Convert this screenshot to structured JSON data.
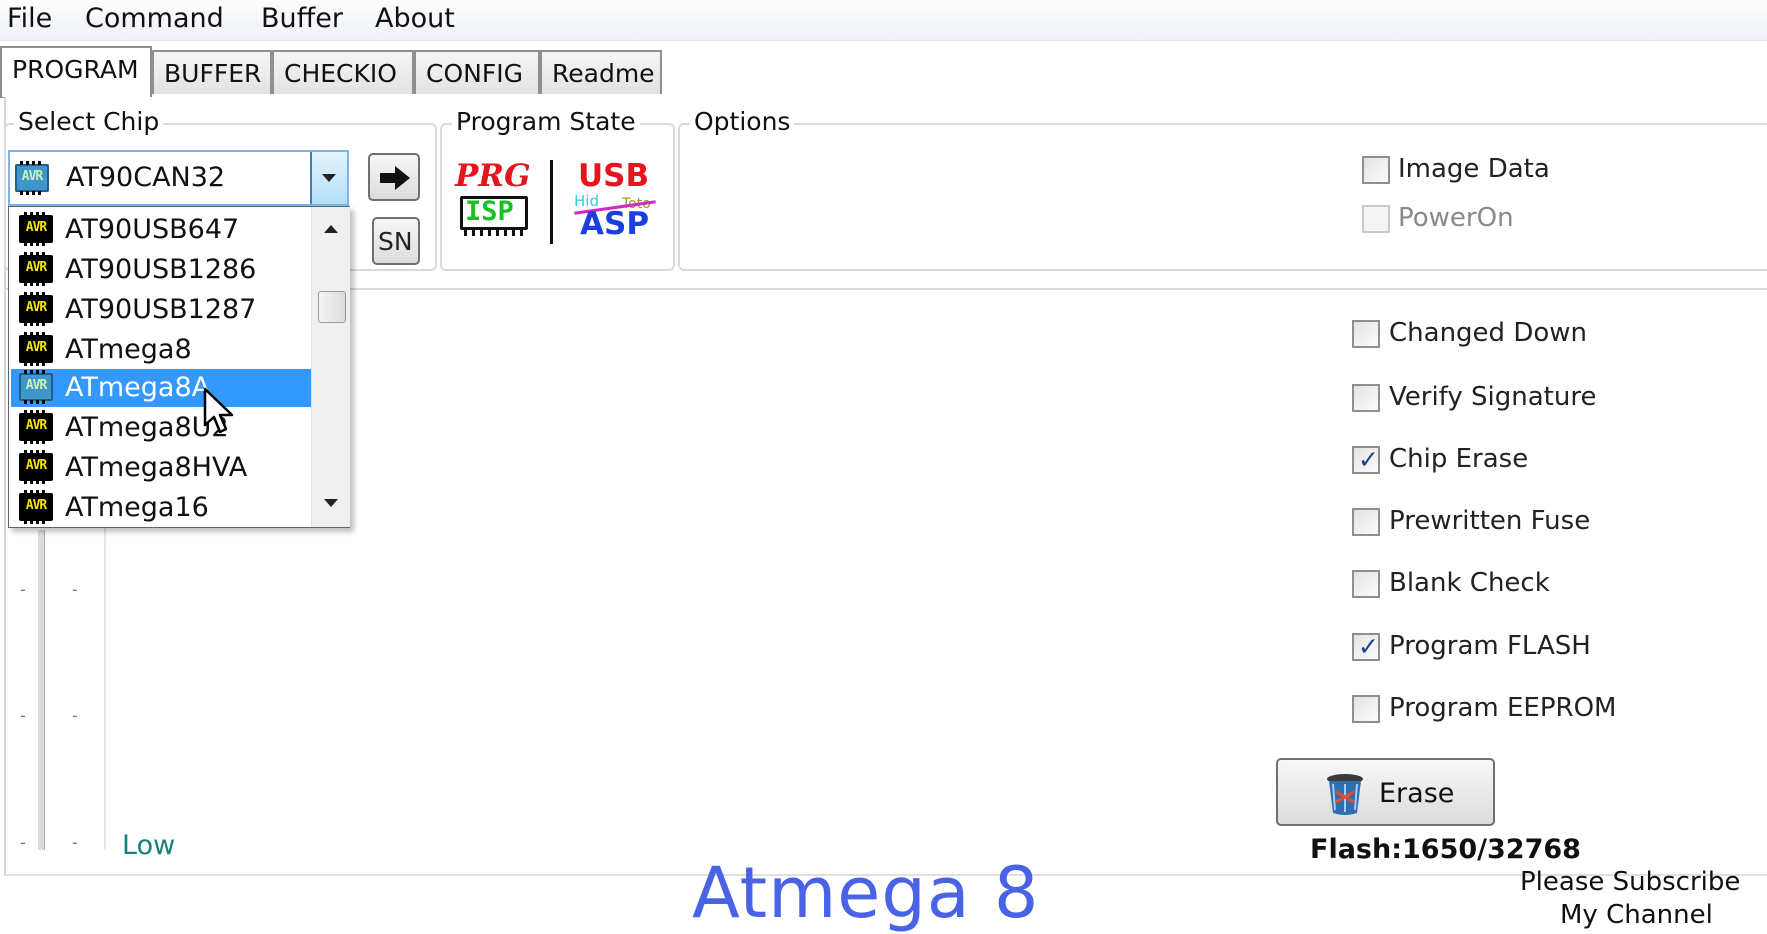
{
  "menu": [
    "File",
    "Command",
    "Buffer",
    "About"
  ],
  "tabs": [
    {
      "label": "PROGRAM",
      "active": true
    },
    {
      "label": "BUFFER",
      "active": false
    },
    {
      "label": "CHECKIO",
      "active": false
    },
    {
      "label": "CONFIG",
      "active": false
    },
    {
      "label": "Readme",
      "active": false
    }
  ],
  "select_chip": {
    "title": "Select Chip",
    "selected": "AT90CAN32",
    "chip_icon_text": "AVR",
    "sn_button": "SN",
    "dropdown_items": [
      {
        "label": "AT90USB647",
        "selected": false
      },
      {
        "label": "AT90USB1286",
        "selected": false
      },
      {
        "label": "AT90USB1287",
        "selected": false
      },
      {
        "label": "ATmega8",
        "selected": false
      },
      {
        "label": "ATmega8A",
        "selected": true
      },
      {
        "label": "ATmega8U2",
        "selected": false
      },
      {
        "label": "ATmega8HVA",
        "selected": false
      },
      {
        "label": "ATmega16",
        "selected": false
      }
    ]
  },
  "program_state": {
    "title": "Program State",
    "prg_logo_top": "PRG",
    "prg_logo_bottom": "ISP",
    "usb_logo_top": "USB",
    "usb_logo_bottom": "ASP",
    "usb_logo_small_left": "Hid",
    "usb_logo_small_right": "Toto"
  },
  "options": {
    "title": "Options",
    "top_checkboxes": [
      {
        "label": "Image Data",
        "checked": false,
        "disabled": false
      },
      {
        "label": "PowerOn",
        "checked": false,
        "disabled": true
      }
    ],
    "checkboxes": [
      {
        "label": "Changed Down",
        "checked": false
      },
      {
        "label": "Verify Signature",
        "checked": false
      },
      {
        "label": "Chip Erase",
        "checked": true
      },
      {
        "label": "Prewritten Fuse",
        "checked": false
      },
      {
        "label": "Blank Check",
        "checked": false
      },
      {
        "label": "Program FLASH",
        "checked": true
      },
      {
        "label": "Program EEPROM",
        "checked": false
      }
    ]
  },
  "erase_button": "Erase",
  "flash_status": "Flash:1650/32768",
  "level_label": "Low",
  "overlay": {
    "caption": "Atmega 8",
    "subscribe_line1": "Please Subscribe",
    "subscribe_line2": "My Channel"
  },
  "colors": {
    "selection": "#3399ff",
    "caption": "#4a63e6",
    "prg_red": "#e8141c",
    "isp_green": "#12c322",
    "usb_red": "#e8141c",
    "asp_blue": "#1a3fe0",
    "low_label": "#16807a"
  }
}
